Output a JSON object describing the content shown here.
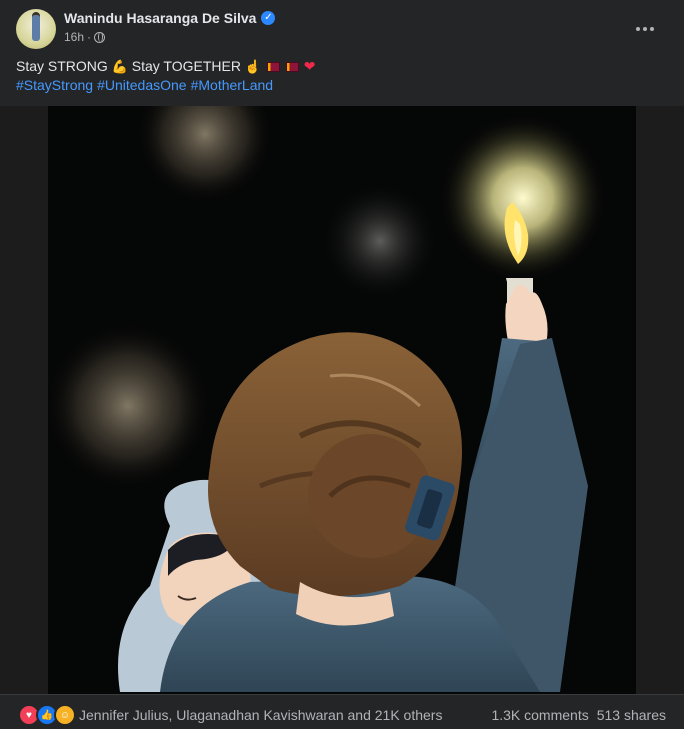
{
  "post": {
    "author": "Wanindu Hasaranga De Silva",
    "time": "16h",
    "text_line1_a": "Stay STRONG",
    "text_line1_b": "Stay TOGETHER",
    "hashtags": [
      "#StayStrong",
      "#UnitedasOne",
      "#MotherLand"
    ]
  },
  "footer": {
    "reactors": "Jennifer Julius, Ulaganadhan Kavishwaran and 21K others",
    "comments": "1.3K comments",
    "shares": "513 shares"
  },
  "colors": {
    "background": "#242526",
    "text": "#e4e6eb",
    "secondary_text": "#b0b3b8",
    "link": "#4599ff",
    "verified": "#2d88ff"
  },
  "icons": [
    "verified-badge-icon",
    "globe-icon",
    "more-options-icon",
    "love-reaction-icon",
    "like-reaction-icon",
    "care-reaction-icon"
  ]
}
